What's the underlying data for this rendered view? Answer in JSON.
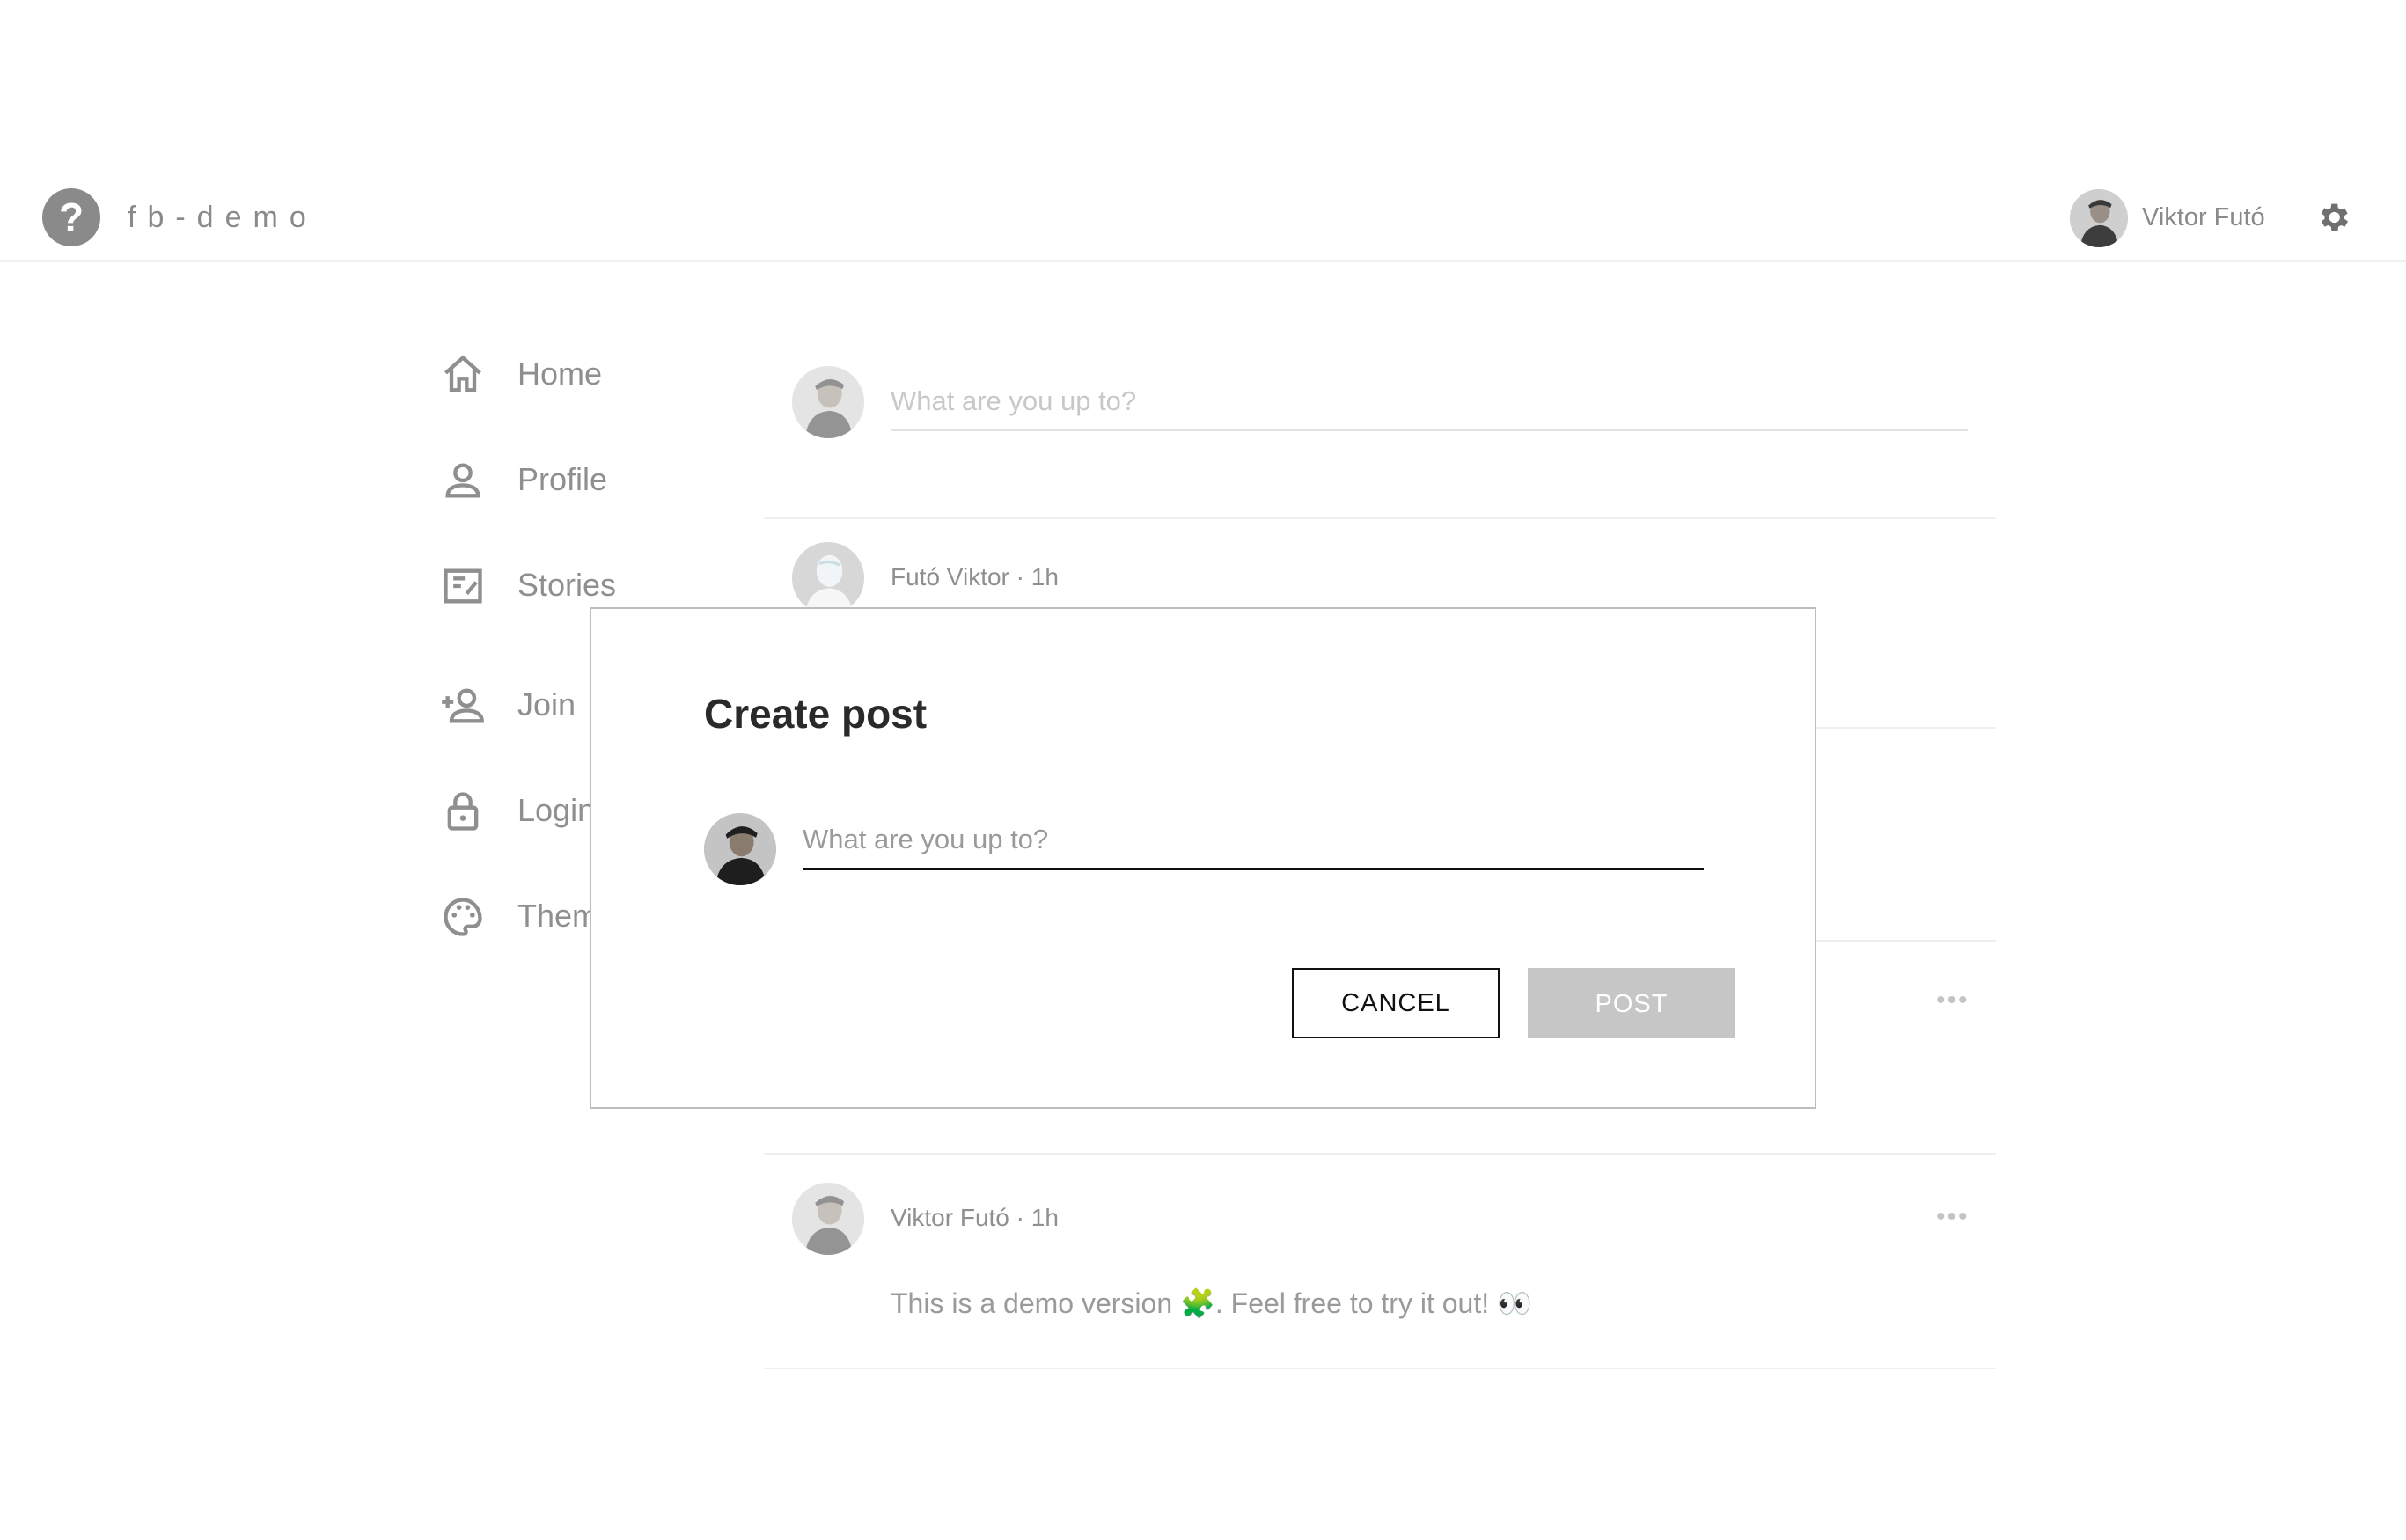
{
  "header": {
    "brand": "fb-demo",
    "user_name": "Viktor Futó"
  },
  "sidebar": {
    "items": [
      {
        "label": "Home",
        "icon": "home-icon"
      },
      {
        "label": "Profile",
        "icon": "person-icon"
      },
      {
        "label": "Stories",
        "icon": "stories-icon"
      },
      {
        "label": "Join",
        "icon": "person-add-icon"
      },
      {
        "label": "Login",
        "icon": "lock-icon"
      },
      {
        "label": "Theme",
        "icon": "palette-icon"
      }
    ]
  },
  "feed": {
    "composer_placeholder": "What are you up to?",
    "posts": [
      {
        "author": "Futó Viktor",
        "time": "1h",
        "meta": "Futó Viktor · 1h"
      },
      {
        "author": "Viktor Futó",
        "time": "1h",
        "meta": "Viktor Futó · 1h",
        "body": "This is a demo version 🧩. Feel free to try it out! 👀"
      }
    ],
    "more_label": "•••"
  },
  "modal": {
    "title": "Create post",
    "input_placeholder": "What are you up to?",
    "cancel_label": "CANCEL",
    "post_label": "POST"
  },
  "colors": {
    "muted_text": "#8f8f8f",
    "disabled_button": "#c6c6c6",
    "modal_border": "#bdbdbd"
  }
}
